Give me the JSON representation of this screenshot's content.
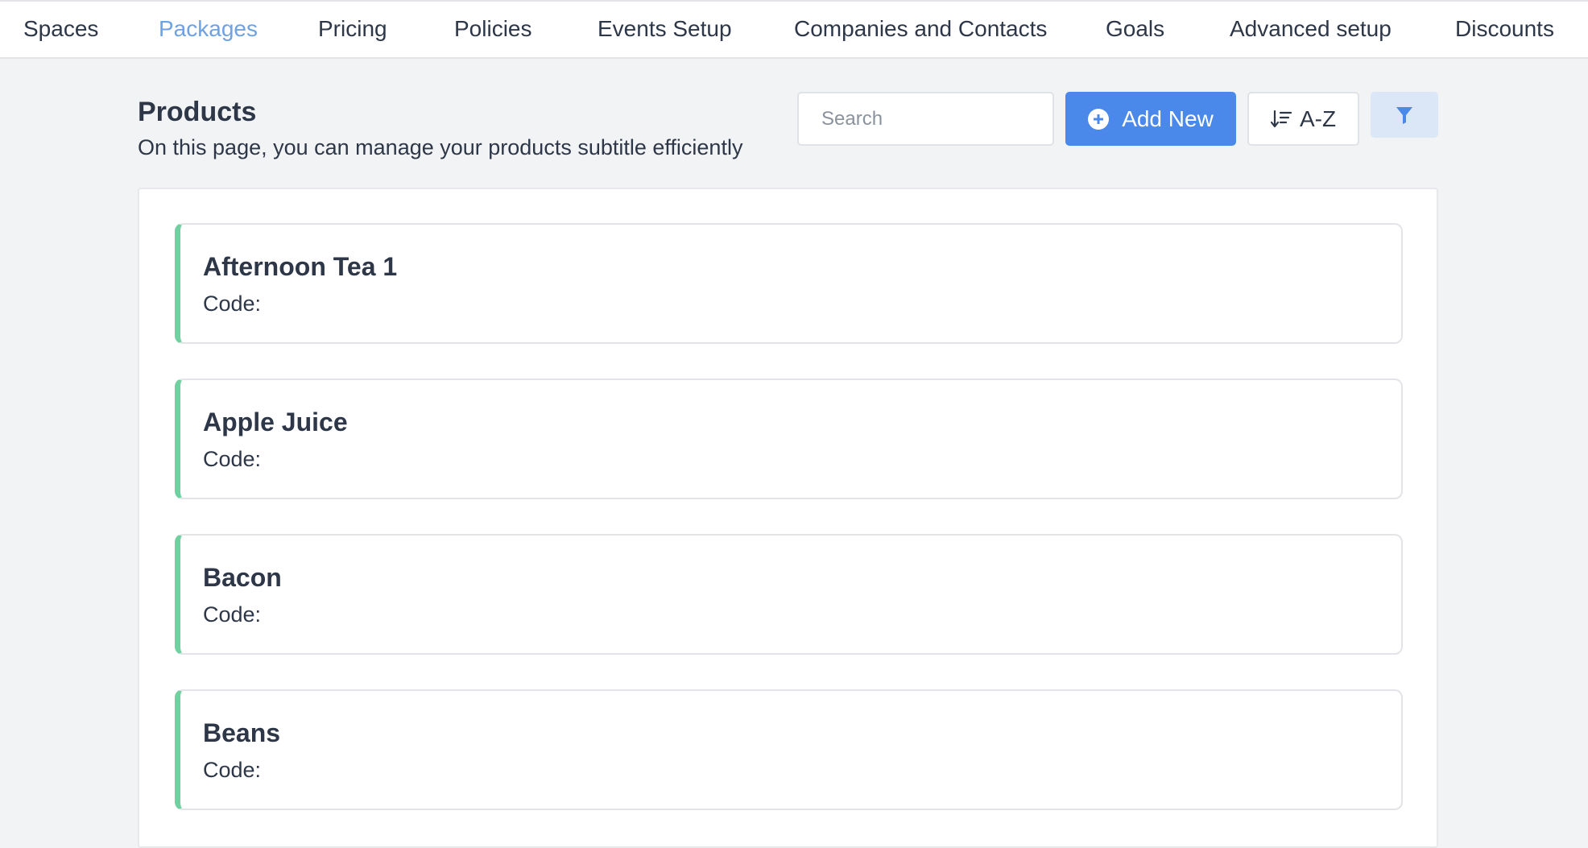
{
  "nav": {
    "tabs": [
      {
        "label": "Spaces"
      },
      {
        "label": "Packages"
      },
      {
        "label": "Pricing"
      },
      {
        "label": "Policies"
      },
      {
        "label": "Events Setup"
      },
      {
        "label": "Companies and Contacts"
      },
      {
        "label": "Goals"
      },
      {
        "label": "Advanced setup"
      },
      {
        "label": "Discounts"
      }
    ],
    "active": "Packages"
  },
  "header": {
    "title": "Products",
    "subtitle": "On this page, you can manage your products subtitle efficiently"
  },
  "toolbar": {
    "search_placeholder": "Search",
    "search_value": "",
    "add_label": "Add New",
    "sort_label": "A-Z",
    "add_icon": "plus-circle-icon",
    "sort_icon": "sort-ascending-icon",
    "filter_icon": "filter-icon"
  },
  "products": [
    {
      "name": "Afternoon Tea 1",
      "code_label": "Code:"
    },
    {
      "name": "Apple Juice",
      "code_label": "Code:"
    },
    {
      "name": "Bacon",
      "code_label": "Code:"
    },
    {
      "name": "Beans",
      "code_label": "Code:"
    }
  ],
  "colors": {
    "accent": "#4a88ea",
    "active_tab": "#6ea2e2",
    "card_stripe": "#6fd0a0",
    "background": "#f2f3f5"
  }
}
